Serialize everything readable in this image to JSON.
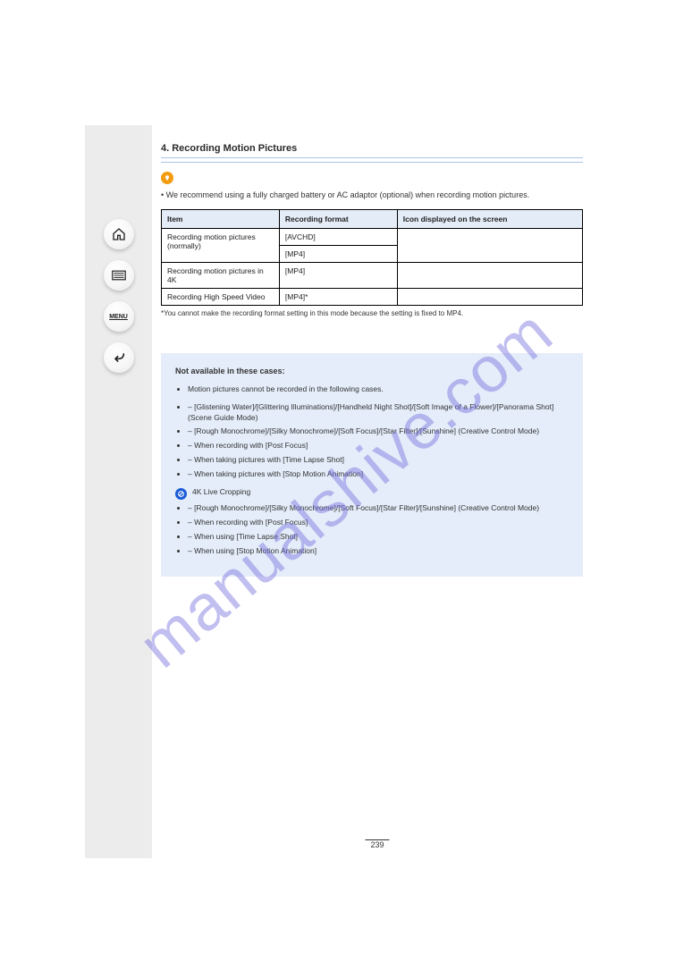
{
  "watermark": "manualshive.com",
  "sidebar": {
    "home": "home",
    "list": "list",
    "menu": "MENU",
    "back": "back"
  },
  "title": "4. Recording Motion Pictures",
  "tip_label": "",
  "tip_text": "• We recommend using a fully charged battery or AC adaptor (optional) when recording motion pictures.",
  "table": {
    "headers": [
      "Item",
      "Recording format",
      "Icon displayed on the screen"
    ],
    "rows": [
      {
        "c1": "Recording motion pictures (normally)",
        "c2": "[AVCHD]",
        "c3": ""
      },
      {
        "c1": "",
        "c2": "[MP4]",
        "c3": ""
      },
      {
        "c1": "Recording motion pictures in 4K",
        "c2": "[MP4]",
        "c3": ""
      },
      {
        "c1": "Recording High Speed Video",
        "c2": "[MP4]*",
        "c3": ""
      }
    ],
    "note": "*You cannot make the recording format setting in this mode because the setting is fixed to MP4."
  },
  "info": {
    "title": "Not available in these cases:",
    "bullets": [
      "Motion pictures cannot be recorded in the following cases.",
      "[Glistening Water]/[Glittering Illuminations]/[Handheld Night Shot]/[Soft Image of a Flower]/[Panorama Shot] (Scene Guide Mode)",
      "[Rough Monochrome]/[Silky Monochrome]/[Soft Focus]/[Star Filter]/[Sunshine] (Creative Control Mode)",
      "When recording with [Post Focus]",
      "When taking pictures with [Time Lapse Shot]",
      "When taking pictures with [Stop Motion Animation]"
    ],
    "blue_line": "4K Live Cropping",
    "sub_items": [
      "[Rough Monochrome]/[Silky Monochrome]/[Soft Focus]/[Star Filter]/[Sunshine] (Creative Control Mode)",
      "When recording with [Post Focus]",
      "When using [Time Lapse Shot]",
      "When using [Stop Motion Animation]"
    ]
  },
  "page_number": "239"
}
